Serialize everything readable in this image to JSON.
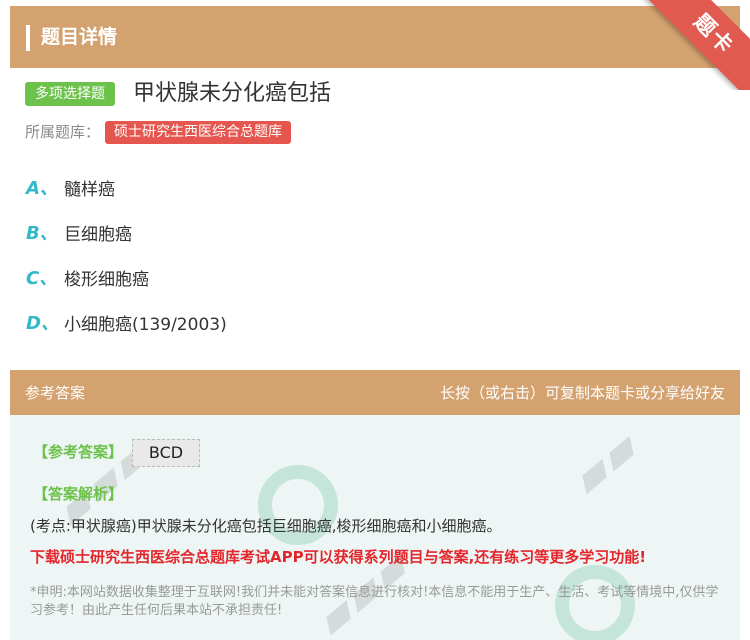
{
  "header": {
    "title": "题目详情"
  },
  "ribbon": {
    "label": "题卡"
  },
  "question": {
    "type_badge": "多项选择题",
    "title": "甲状腺未分化癌包括",
    "bank_label": "所属题库：",
    "bank_name": "硕士研究生西医综合总题库"
  },
  "options": [
    {
      "letter": "A、",
      "text": "髓样癌"
    },
    {
      "letter": "B、",
      "text": "巨细胞癌"
    },
    {
      "letter": "C、",
      "text": "梭形细胞癌"
    },
    {
      "letter": "D、",
      "text": "小细胞癌(139/2003)"
    }
  ],
  "answer_section": {
    "header_left": "参考答案",
    "header_right": "长按（或右击）可复制本题卡或分享给好友",
    "answer_label": "【参考答案】",
    "answer_value": "BCD",
    "analysis_label": "【答案解析】",
    "analysis_text": "(考点:甲状腺癌)甲状腺未分化癌包括巨细胞癌,梭形细胞癌和小细胞癌。",
    "promo_text": "下载硕士研究生西医综合总题库考试APP可以获得系列题目与答案,还有练习等更多学习功能!",
    "disclaimer": "*申明:本网站数据收集整理于互联网!我们并未能对答案信息进行核对!本信息不能用于生产、生活、考试等情境中,仅供学习参考！由此产生任何后果本站不承担责任!"
  },
  "colors": {
    "header_bg": "#d4a26f",
    "type_badge": "#6dc24b",
    "bank_tag": "#e5574e",
    "option_letter": "#33b8c8",
    "promo": "#e3262c",
    "ribbon": "#e05a4f"
  }
}
